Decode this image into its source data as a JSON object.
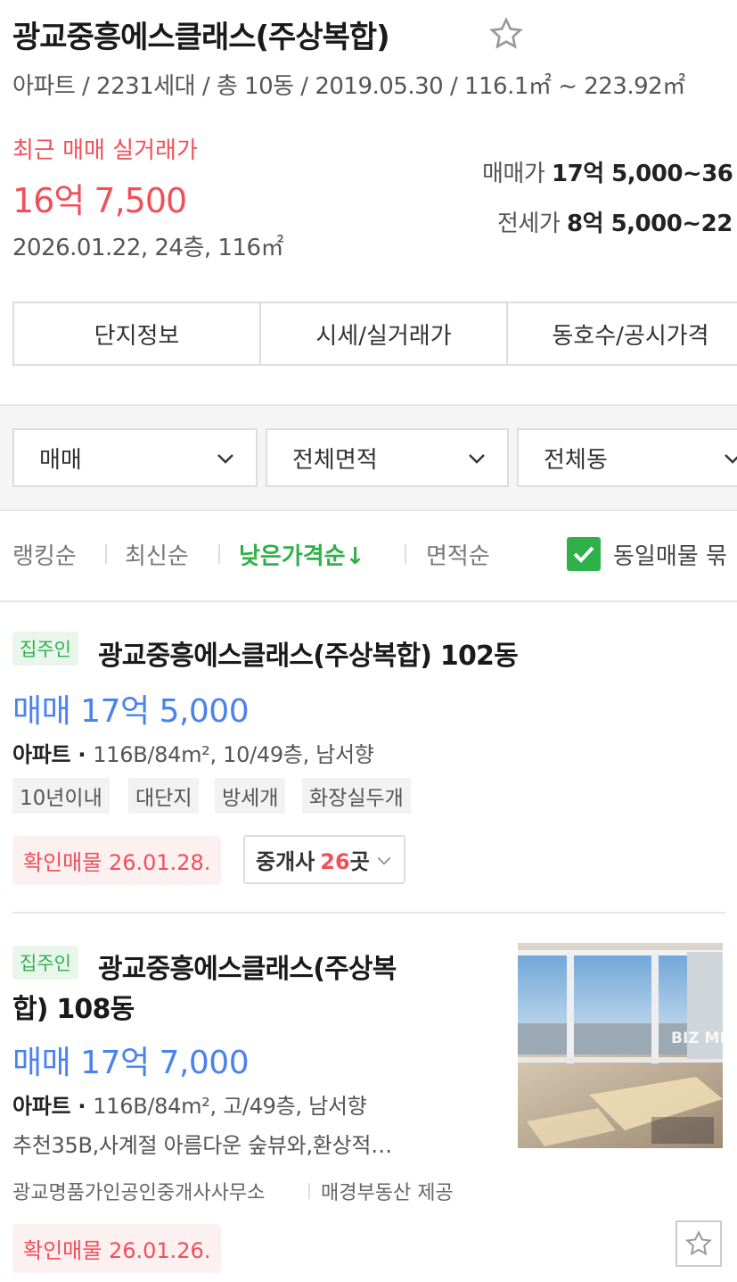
{
  "header": {
    "title": "광교중흥에스클래스(주상복합)",
    "meta": "아파트 / 2231세대 / 총 10동 / 2019.05.30 / 116.1㎡ ~ 223.92㎡",
    "recent_label": "최근 매매 실거래가",
    "recent_price": "16억 7,500",
    "recent_date": "2026.01.22, 24층, 116㎡",
    "sale_label": "매매가",
    "sale_range": "17억 5,000~36",
    "jeonse_label": "전세가",
    "jeonse_range": "8억 5,000~22"
  },
  "tabs": [
    "단지정보",
    "시세/실거래가",
    "동호수/공시가격"
  ],
  "filters": {
    "deal": "매매",
    "area": "전체면적",
    "dong": "전체동"
  },
  "sort": {
    "items": [
      "랭킹순",
      "최신순",
      "낮은가격순↓",
      "면적순"
    ],
    "active_index": 2,
    "same_listing_label": "동일매물 묶",
    "same_listing_checked": true
  },
  "listings": [
    {
      "badge": "집주인",
      "title": "광교중흥에스클래스(주상복합) 102동",
      "price": "매매 17억 5,000",
      "type": "아파트",
      "spec": "116B/84m², 10/49층, 남서향",
      "tags": [
        "10년이내",
        "대단지",
        "방세개",
        "화장실두개"
      ],
      "confirm": "확인매물 26.01.28.",
      "agents_prefix": "중개사",
      "agents_count": "26",
      "agents_suffix": "곳"
    },
    {
      "badge": "집주인",
      "title_line1": "광교중흥에스클래스(주상복",
      "title_line2": "합) 108동",
      "price": "매매 17억 7,000",
      "type": "아파트",
      "spec": "116B/84m², 고/49층, 남서향",
      "desc": "추천35B,사계절 아름다운 숲뷰와,환상적…",
      "agency": "광교명품가인공인중개사사무소",
      "provider": "매경부동산 제공",
      "confirm": "확인매물 26.01.26.",
      "photo_watermark": "BIZ MI"
    }
  ],
  "colors": {
    "accent_green": "#2fb14a",
    "price_blue": "#4a82f0",
    "alert_red": "#f0505a"
  }
}
